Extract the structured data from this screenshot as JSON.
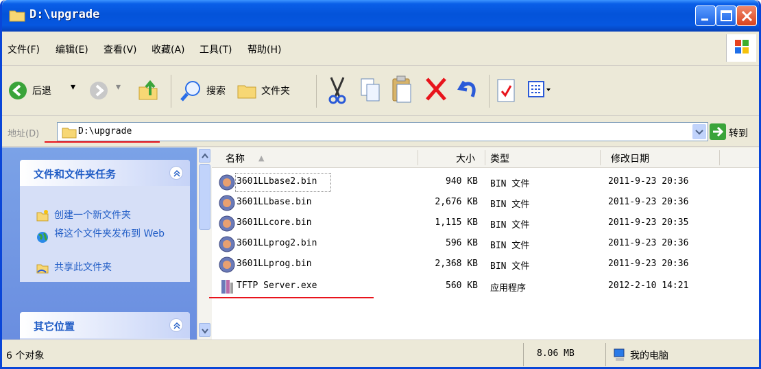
{
  "window": {
    "title": "D:\\upgrade"
  },
  "menu": [
    "文件(F)",
    "编辑(E)",
    "查看(V)",
    "收藏(A)",
    "工具(T)",
    "帮助(H)"
  ],
  "toolbar": {
    "back_label": "后退",
    "search_label": "搜索",
    "folders_label": "文件夹"
  },
  "address": {
    "label": "地址(D)",
    "value": "D:\\upgrade",
    "go_label": "转到"
  },
  "tasks": {
    "header": "文件和文件夹任务",
    "links": [
      "创建一个新文件夹",
      "将这个文件夹发布到 Web",
      "共享此文件夹"
    ],
    "other_header": "其它位置"
  },
  "columns": {
    "name": "名称",
    "size": "大小",
    "type": "类型",
    "modified": "修改日期"
  },
  "files": [
    {
      "name": "3601LLbase2.bin",
      "size": "940 KB",
      "type": "BIN 文件",
      "modified": "2011-9-23 20:36"
    },
    {
      "name": "3601LLbase.bin",
      "size": "2,676 KB",
      "type": "BIN 文件",
      "modified": "2011-9-23 20:36"
    },
    {
      "name": "3601LLcore.bin",
      "size": "1,115 KB",
      "type": "BIN 文件",
      "modified": "2011-9-23 20:35"
    },
    {
      "name": "3601LLprog2.bin",
      "size": "596 KB",
      "type": "BIN 文件",
      "modified": "2011-9-23 20:36"
    },
    {
      "name": "3601LLprog.bin",
      "size": "2,368 KB",
      "type": "BIN 文件",
      "modified": "2011-9-23 20:36"
    },
    {
      "name": "TFTP Server.exe",
      "size": "560 KB",
      "type": "应用程序",
      "modified": "2012-2-10 14:21"
    }
  ],
  "status": {
    "count": "6 个对象",
    "size": "8.06 MB",
    "location": "我的电脑"
  }
}
